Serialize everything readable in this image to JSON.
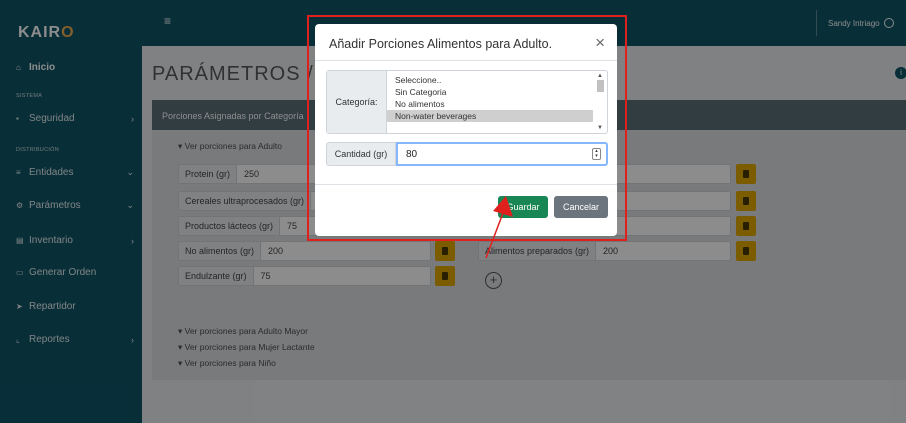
{
  "app": {
    "logo_main": "KAIR",
    "logo_accent": "O"
  },
  "topbar": {
    "user_name": "Sandy Intriago"
  },
  "sidebar": {
    "sections": [
      "SISTEMA",
      "DISTRIBUCIÓN"
    ],
    "items": [
      {
        "label": "Inicio",
        "icon": "home-icon"
      },
      {
        "label": "Seguridad",
        "icon": "lock-icon"
      },
      {
        "label": "Entidades",
        "icon": "list-icon"
      },
      {
        "label": "Parámetros",
        "icon": "gear-icon"
      },
      {
        "label": "Inventario",
        "icon": "box-icon"
      },
      {
        "label": "Generar Orden",
        "icon": "cart-icon"
      },
      {
        "label": "Repartidor",
        "icon": "send-icon"
      },
      {
        "label": "Reportes",
        "icon": "chart-icon"
      }
    ]
  },
  "main": {
    "title": "PARÁMETROS / REG",
    "card_header": "Porciones Asignadas por Categoría",
    "toggle_adult": "▾ Ver porciones para Adulto",
    "fields_left": [
      {
        "label": "Protein (gr)",
        "value": "250"
      },
      {
        "label": "Cereales ultraprocesados (gr)",
        "value": ""
      },
      {
        "label": "Productos lácteos (gr)",
        "value": "75"
      },
      {
        "label": "No alimentos (gr)",
        "value": "200"
      },
      {
        "label": "Endulzante (gr)",
        "value": "75"
      }
    ],
    "fields_right": [
      {
        "label": "",
        "value": ""
      },
      {
        "label": "gr",
        "value": "75"
      },
      {
        "label": "",
        "value": "250"
      },
      {
        "label": "Alimentos preparados (gr)",
        "value": "200"
      }
    ],
    "toggles_more": [
      "▾ Ver porciones para Adulto Mayor",
      "▾ Ver porciones para Mujer Lactante",
      "▾ Ver porciones para Niño"
    ],
    "add_symbol": "+"
  },
  "modal": {
    "title": "Añadir Porciones Alimentos para Adulto.",
    "close": "×",
    "category_label": "Categoría:",
    "category_options": [
      "Seleccione..",
      "Sin Categoria",
      "No alimentos",
      "Non-water beverages"
    ],
    "category_selected": "Non-water beverages",
    "quantity_label": "Cantidad (gr)",
    "quantity_value": "80",
    "save_label": "Guardar",
    "cancel_label": "Cancelar"
  },
  "colors": {
    "sidebar_bg": "#0f5567",
    "accent": "#f0ad4e",
    "save": "#198754",
    "cancel": "#6c757d",
    "trash": "#e0a800",
    "highlight": "#e0201d"
  }
}
